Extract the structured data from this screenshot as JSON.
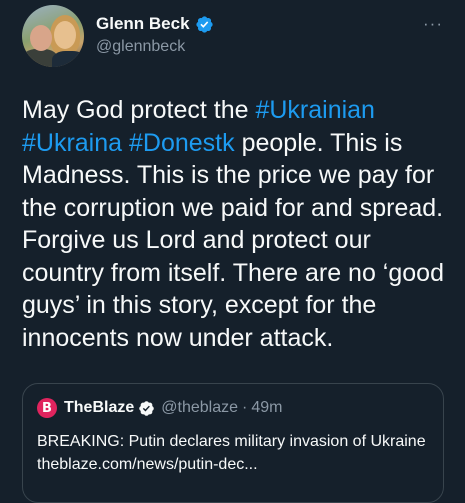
{
  "author": {
    "display_name": "Glenn Beck",
    "handle": "@glennbeck",
    "verified": true,
    "more_icon": "more-horizontal-icon"
  },
  "tweet": {
    "segments": [
      {
        "text": "May God protect the ",
        "type": "text"
      },
      {
        "text": "#Ukrainian",
        "type": "hashtag"
      },
      {
        "text": " ",
        "type": "text"
      },
      {
        "text": "#Ukraina",
        "type": "hashtag"
      },
      {
        "text": " ",
        "type": "text"
      },
      {
        "text": "#Donestk",
        "type": "hashtag"
      },
      {
        "text": " people.  This is Madness.  This is the price we pay for the corruption we paid for and spread. Forgive us Lord and protect our country from itself. There are no ‘good guys’ in this story, except for the innocents now under attack.",
        "type": "text"
      }
    ]
  },
  "quote": {
    "logo_letter": "B",
    "name": "TheBlaze",
    "verified": true,
    "handle": "@theblaze",
    "separator": "·",
    "time": "49m",
    "text": "BREAKING: Putin declares military invasion of Ukraine theblaze.com/news/putin-dec..."
  },
  "colors": {
    "background": "#15202b",
    "text": "#f7f9f9",
    "secondary": "#8b98a5",
    "link": "#1d9bf0",
    "verified": "#1d9bf0",
    "blaze": "#e0245e",
    "border": "#38444d"
  }
}
